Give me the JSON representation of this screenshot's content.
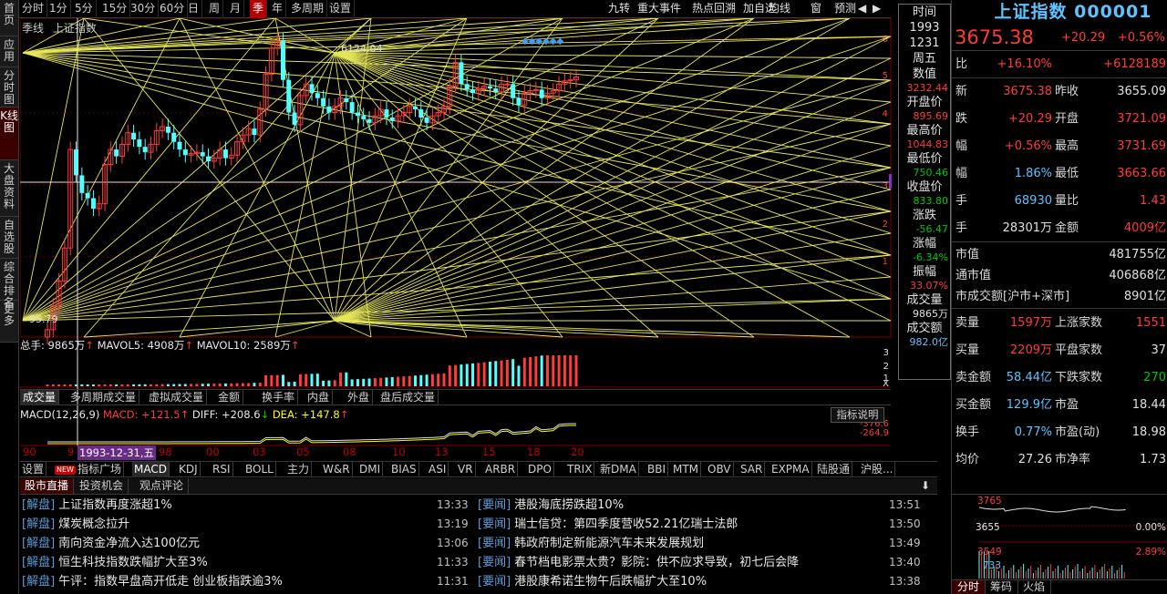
{
  "left_sidebar": [
    "首页",
    "应用",
    "分时图",
    "K线图",
    "大盘资料",
    "自选股",
    "综合排名",
    "更多"
  ],
  "top_periods": [
    "分时",
    "1分",
    "5分",
    "15分",
    "30分",
    "60分",
    "日",
    "周",
    "月",
    "季",
    "年",
    "多周期",
    "设置"
  ],
  "top_right": [
    "九转",
    "重大事件",
    "热点回溯",
    "加自选",
    "均线",
    "窗",
    "预测",
    "◀",
    "▶"
  ],
  "chart_header": {
    "period": "季线",
    "name": "上证指数"
  },
  "price_axis": [
    "6",
    "5",
    "4",
    "3",
    "2",
    "1"
  ],
  "annotations": {
    "high": "6124.04",
    "low": "95.79",
    "diamonds": "◆◆◆◆◆◆"
  },
  "volume_legend": {
    "total": "总手: 9865万",
    "mavol5": "MAVOL5: 4908万",
    "mavol10": "MAVOL10: 2589万",
    "axis": [
      "3",
      "2",
      "1",
      "X"
    ]
  },
  "volume_tabs": [
    "成交量",
    "多周期成交量",
    "虚拟成交量",
    "金额",
    "换手率",
    "内盘",
    "外盘",
    "盘后成交量"
  ],
  "macd_legend": {
    "name": "MACD(12,26,9)",
    "macd": "MACD: +121.5",
    "diff": "DIFF: +208.6",
    "dea": "DEA: +147.8",
    "btn": "指标说明",
    "axis_a": "-376.6",
    "axis_b": "-264.9"
  },
  "xaxis": [
    "90",
    "9",
    "98",
    "00",
    "03",
    "05",
    "08",
    "10",
    "13",
    "15",
    "18",
    "20"
  ],
  "xaxis_hl": "1993-12-31,五",
  "ind_tabs": [
    "设置",
    "指标广场",
    "MACD",
    "KDJ",
    "RSI",
    "BOLL",
    "主力",
    "W&R",
    "DMI",
    "BIAS",
    "ASI",
    "VR",
    "ARBR",
    "DPO",
    "TRIX",
    "新DMA",
    "BBI",
    "MTM",
    "OBV",
    "SAR",
    "EXPMA",
    "陆股通",
    "沪股..."
  ],
  "new_badge": "NEW",
  "news_tabs": [
    "股市直播",
    "投资机会",
    "观点评论"
  ],
  "news_icon": "⬇",
  "news_left": [
    {
      "tag": "[解盘]",
      "title": "上证指数再度涨超1%",
      "time": "13:33"
    },
    {
      "tag": "[解盘]",
      "title": "煤炭概念拉升",
      "time": "13:19"
    },
    {
      "tag": "[解盘]",
      "title": "南向资金净流入达100亿元",
      "time": "13:06"
    },
    {
      "tag": "[解盘]",
      "title": "恒生科技指数跌幅扩大至3%",
      "time": "11:33"
    },
    {
      "tag": "[解盘]",
      "title": "午评：指数早盘高开低走 创业板指跌逾3%",
      "time": "11:31"
    }
  ],
  "news_right": [
    {
      "tag": "[要闻]",
      "title": "港股海底捞跌超10%",
      "time": "13:51"
    },
    {
      "tag": "[要闻]",
      "title": "瑞士信贷：第四季度营收52.21亿瑞士法郎",
      "time": "13:50"
    },
    {
      "tag": "[要闻]",
      "title": "韩政府制定新能源汽车未来发展规划",
      "time": "13:49"
    },
    {
      "tag": "[要闻]",
      "title": "春节档电影票太贵？影院：供不应求导致，初七后会降",
      "time": "13:40"
    },
    {
      "tag": "[要闻]",
      "title": "港股康希诺生物午后跌幅扩大至10%",
      "time": "13:38"
    }
  ],
  "tips": [
    {
      "l": "时间",
      "v": ""
    },
    {
      "l": "1993",
      "v": ""
    },
    {
      "l": "1231",
      "v": ""
    },
    {
      "l": "周五",
      "v": ""
    },
    {
      "l": "数值",
      "v": "3232.44"
    },
    {
      "l": "开盘价",
      "v": "895.69"
    },
    {
      "l": "最高价",
      "v": "1044.83"
    },
    {
      "l": "最低价",
      "v": "750.46"
    },
    {
      "l": "收盘价",
      "v": "833.80"
    },
    {
      "l": "涨跌",
      "v": "-56.47"
    },
    {
      "l": "涨幅",
      "v": "-6.34%"
    },
    {
      "l": "振幅",
      "v": "33.07%"
    },
    {
      "l": "成交量",
      "v": "9865万"
    },
    {
      "l": "成交额",
      "v": "982.0亿"
    }
  ],
  "quote": {
    "title": "上证指数 000001",
    "price": "3675.38",
    "change": "+20.29",
    "pct": "+0.56%",
    "rows": [
      {
        "a": "比",
        "av": "+16.10%",
        "b": "",
        "bv": "+6128189"
      },
      {
        "a": "新",
        "av": "3675.38",
        "b": "昨收",
        "bv": "3655.09"
      },
      {
        "a": "跌",
        "av": "+20.29",
        "b": "开盘",
        "bv": "3721.09"
      },
      {
        "a": "幅",
        "av": "+0.56%",
        "b": "最高",
        "bv": "3731.69"
      },
      {
        "a": "幅",
        "av": "1.86%",
        "b": "最低",
        "bv": "3663.66"
      },
      {
        "a": "手",
        "av": "68930",
        "b": "量比",
        "bv": "1.43"
      },
      {
        "a": "手",
        "av": "28301万",
        "b": "金额",
        "bv": "4009亿"
      }
    ],
    "rows2": [
      {
        "a": "市值",
        "av": "",
        "b": "",
        "bv": "481755亿"
      },
      {
        "a": "通市值",
        "av": "",
        "b": "",
        "bv": "406868亿"
      },
      {
        "a": "市成交额[沪市+深市]",
        "av": "",
        "b": "",
        "bv": "8901亿"
      }
    ],
    "rows3": [
      {
        "a": "卖量",
        "av": "1597万",
        "b": "上涨家数",
        "bv": "1551"
      },
      {
        "a": "买量",
        "av": "2209万",
        "b": "平盘家数",
        "bv": "37"
      },
      {
        "a": "卖金额",
        "av": "58.44亿",
        "b": "下跌家数",
        "bv": "270"
      },
      {
        "a": "买金额",
        "av": "129.9亿",
        "b": "市盈",
        "bv": "18.44"
      },
      {
        "a": "换手",
        "av": "0.77%",
        "b": "市盈(动)",
        "bv": "18.98"
      },
      {
        "a": "均价",
        "av": "27.26",
        "b": "市净率",
        "bv": "1.73"
      }
    ],
    "mini_axis": {
      "top": "3765",
      "mid": "3655",
      "pct0": "0.00%",
      "v1": "3549",
      "v2": "733",
      "pct": "2.89%"
    },
    "mini_tabs": [
      "分时",
      "筹码",
      "火焰"
    ]
  },
  "colors": {
    "up": "#ff3b3b",
    "down": "#00c800",
    "line": "#ffff66",
    "candle_down": "#54ffff"
  }
}
